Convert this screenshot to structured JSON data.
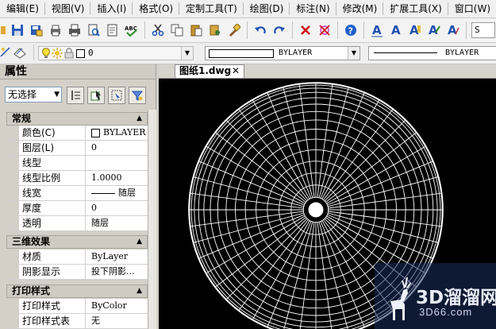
{
  "menu": [
    "编辑(E)",
    "视图(V)",
    "插入(I)",
    "格式(O)",
    "定制工具(T)",
    "绘图(D)",
    "标注(N)",
    "修改(M)",
    "扩展工具(X)",
    "窗口(W)"
  ],
  "toolbar1": {
    "partial_combo": "S"
  },
  "layer_bar": {
    "layer_value": "0",
    "color_value": "BYLAYER",
    "linetype_value": "BYLAYER"
  },
  "properties": {
    "title": "属性",
    "selection": "无选择",
    "sections": {
      "general": {
        "title": "常规",
        "rows": [
          {
            "label": "颜色(C)",
            "value": "BYLAYER"
          },
          {
            "label": "图层(L)",
            "value": "0"
          },
          {
            "label": "线型",
            "value": ""
          },
          {
            "label": "线型比例",
            "value": "1.0000"
          },
          {
            "label": "线宽",
            "value": "随层"
          },
          {
            "label": "厚度",
            "value": "0"
          },
          {
            "label": "透明",
            "value": "随层"
          }
        ]
      },
      "three_d": {
        "title": "三维效果",
        "rows": [
          {
            "label": "材质",
            "value": "ByLayer"
          },
          {
            "label": "阴影显示",
            "value": "投下阴影..."
          }
        ]
      },
      "print": {
        "title": "打印样式",
        "rows": [
          {
            "label": "打印样式",
            "value": "ByColor"
          },
          {
            "label": "打印样式表",
            "value": "无"
          }
        ]
      }
    }
  },
  "drawing": {
    "tab_label": "图纸1.dwg",
    "close_glyph": "✕"
  },
  "watermark": {
    "brand": "3D溜溜网",
    "url": "3D66.com"
  }
}
